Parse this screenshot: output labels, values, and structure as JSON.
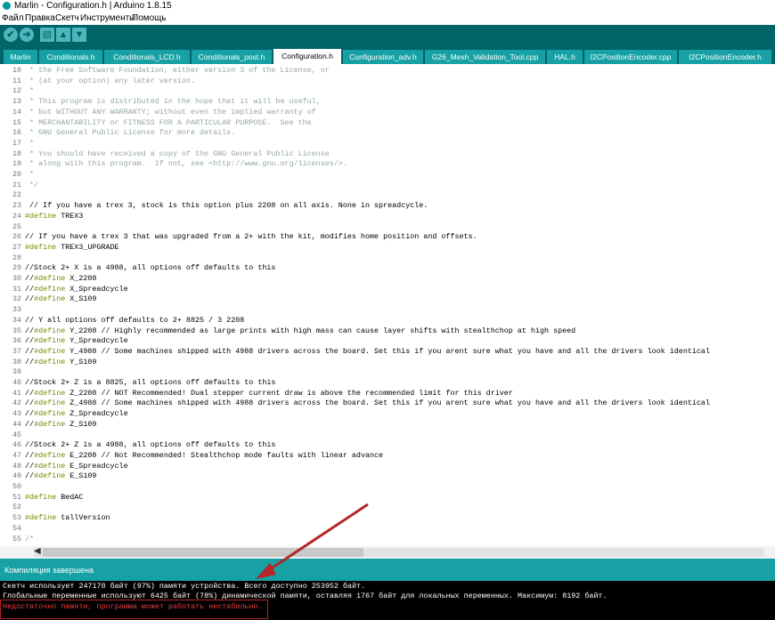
{
  "window": {
    "title": "Marlin - Configuration.h | Arduino 1.8.15"
  },
  "menu": [
    "Файл",
    "Правка",
    "Скетч",
    "Инструменты",
    "Помощь"
  ],
  "toolbar": {
    "buttons": [
      {
        "name": "verify-button",
        "icon": "check-icon",
        "glyph": "✔"
      },
      {
        "name": "upload-button",
        "icon": "arrow-right-icon",
        "glyph": "➜"
      },
      {
        "name": "new-button",
        "icon": "new-file-icon",
        "glyph": "▤"
      },
      {
        "name": "open-button",
        "icon": "upload-arrow-icon",
        "glyph": "▲"
      },
      {
        "name": "save-button",
        "icon": "download-arrow-icon",
        "glyph": "▼"
      }
    ]
  },
  "tabs": [
    {
      "label": "Marlin",
      "active": false
    },
    {
      "label": "Conditionals.h",
      "active": false
    },
    {
      "label": "Conditionals_LCD.h",
      "active": false
    },
    {
      "label": "Conditionals_post.h",
      "active": false
    },
    {
      "label": "Configuration.h",
      "active": true
    },
    {
      "label": "Configuration_adv.h",
      "active": false
    },
    {
      "label": "G26_Mesh_Validation_Tool.cpp",
      "active": false
    },
    {
      "label": "HAL.h",
      "active": false
    },
    {
      "label": "I2CPositionEncoder.cpp",
      "active": false
    },
    {
      "label": "I2CPositionEncoder.h",
      "active": false
    }
  ],
  "code_lines": [
    {
      "n": "10",
      "t": " * the Free Software Foundation, either version 3 of the License, or",
      "c": true
    },
    {
      "n": "11",
      "t": " * (at your option) any later version.",
      "c": true
    },
    {
      "n": "12",
      "t": " *",
      "c": true
    },
    {
      "n": "13",
      "t": " * This program is distributed in the hope that it will be useful,",
      "c": true
    },
    {
      "n": "14",
      "t": " * but WITHOUT ANY WARRANTY; without even the implied warranty of",
      "c": true
    },
    {
      "n": "15",
      "t": " * MERCHANTABILITY or FITNESS FOR A PARTICULAR PURPOSE.  See the",
      "c": true
    },
    {
      "n": "16",
      "t": " * GNU General Public License for more details.",
      "c": true
    },
    {
      "n": "17",
      "t": " *",
      "c": true
    },
    {
      "n": "18",
      "t": " * You should have received a copy of the GNU General Public License",
      "c": true
    },
    {
      "n": "19",
      "t": " * along with this program.  If not, see <http://www.gnu.org/licenses/>.",
      "c": true
    },
    {
      "n": "20",
      "t": " *",
      "c": true
    },
    {
      "n": "21",
      "t": " */",
      "c": true
    },
    {
      "n": "22",
      "t": "",
      "c": false
    },
    {
      "n": "23",
      "t": " // If you have a trex 3, stock is this option plus 2208 on all axis. None in spreadcycle.",
      "c": false
    },
    {
      "n": "24",
      "t": "#define TREX3",
      "c": false
    },
    {
      "n": "25",
      "t": "",
      "c": false
    },
    {
      "n": "26",
      "t": "// If you have a trex 3 that was upgraded from a 2+ with the kit, modifies home position and offsets.",
      "c": false
    },
    {
      "n": "27",
      "t": "#define TREX3_UPGRADE",
      "c": false
    },
    {
      "n": "28",
      "t": "",
      "c": false
    },
    {
      "n": "29",
      "t": "//Stock 2+ X is a 4988, all options off defaults to this",
      "c": false
    },
    {
      "n": "30",
      "t": "//#define X_2208",
      "c": false
    },
    {
      "n": "31",
      "t": "//#define X_Spreadcycle",
      "c": false
    },
    {
      "n": "32",
      "t": "//#define X_S109",
      "c": false
    },
    {
      "n": "33",
      "t": "",
      "c": false
    },
    {
      "n": "34",
      "t": "// Y all options off defaults to 2+ 8825 / 3 2208",
      "c": false
    },
    {
      "n": "35",
      "t": "//#define Y_2208 // Highly recommended as large prints with high mass can cause layer shifts with stealthchop at high speed",
      "c": false
    },
    {
      "n": "36",
      "t": "//#define Y_Spreadcycle",
      "c": false
    },
    {
      "n": "37",
      "t": "//#define Y_4988 // Some machines shipped with 4988 drivers across the board. Set this if you arent sure what you have and all the drivers look identical",
      "c": false
    },
    {
      "n": "38",
      "t": "//#define Y_S109",
      "c": false
    },
    {
      "n": "39",
      "t": "",
      "c": false
    },
    {
      "n": "40",
      "t": "//Stock 2+ Z is a 8825, all options off defaults to this",
      "c": false
    },
    {
      "n": "41",
      "t": "//#define Z_2208 // NOT Recommended! Dual stepper current draw is above the recommended limit for this driver",
      "c": false
    },
    {
      "n": "42",
      "t": "//#define Z_4988 // Some machines shipped with 4988 drivers across the board. Set this if you arent sure what you have and all the drivers look identical",
      "c": false
    },
    {
      "n": "43",
      "t": "//#define Z_Spreadcycle",
      "c": false
    },
    {
      "n": "44",
      "t": "//#define Z_S109",
      "c": false
    },
    {
      "n": "45",
      "t": "",
      "c": false
    },
    {
      "n": "46",
      "t": "//Stock 2+ Z is a 4988, all options off defaults to this",
      "c": false
    },
    {
      "n": "47",
      "t": "//#define E_2208 // Not Recommended! Stealthchop mode faults with linear advance",
      "c": false
    },
    {
      "n": "48",
      "t": "//#define E_Spreadcycle",
      "c": false
    },
    {
      "n": "49",
      "t": "//#define E_S109",
      "c": false
    },
    {
      "n": "50",
      "t": "",
      "c": false
    },
    {
      "n": "51",
      "t": "#define BedAC",
      "c": false
    },
    {
      "n": "52",
      "t": "",
      "c": false
    },
    {
      "n": "53",
      "t": "#define tallVersion",
      "c": false
    },
    {
      "n": "54",
      "t": "",
      "c": false
    },
    {
      "n": "55",
      "t": "/*",
      "c": true
    }
  ],
  "status": {
    "text": "Компиляция завершена"
  },
  "console": {
    "lines": [
      {
        "text": "Скетч использует 247170 байт (97%) памяти устройства. Всего доступно 253952 байт.",
        "error": false
      },
      {
        "text": "Глобальные переменные используют 6425 байт (78%) динамической памяти, оставляя 1767 байт для локальных переменных. Максимум: 8192 байт.",
        "error": false
      },
      {
        "text": "Недостаточно памяти, программа может работать нестабильно.",
        "error": true
      }
    ]
  },
  "colors": {
    "toolbar": "#006468",
    "tab": "#17a1a5",
    "status": "#17a1a5",
    "comment": "#95a5a6",
    "keyword": "#728e00",
    "error": "#ec3b3b",
    "annotation": "#b52626"
  }
}
